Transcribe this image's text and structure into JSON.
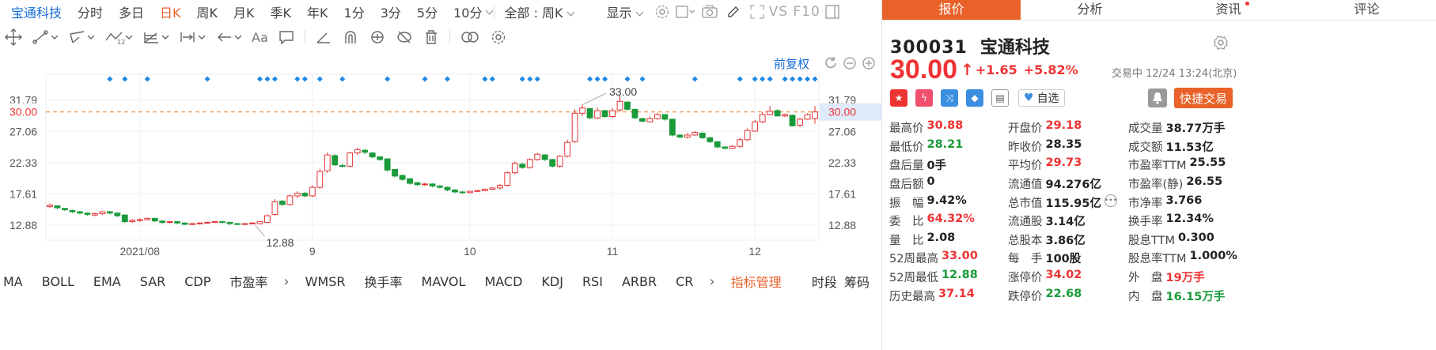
{
  "period_bar": {
    "items": [
      {
        "label": "宝通科技",
        "name": "stock-name-tab",
        "state": "first"
      },
      {
        "label": "分时",
        "name": "period-intraday"
      },
      {
        "label": "多日",
        "name": "period-multi-day"
      },
      {
        "label": "日K",
        "name": "period-daily",
        "state": "active"
      },
      {
        "label": "周K",
        "name": "period-weekly"
      },
      {
        "label": "月K",
        "name": "period-monthly"
      },
      {
        "label": "季K",
        "name": "period-quarterly"
      },
      {
        "label": "年K",
        "name": "period-yearly"
      },
      {
        "label": "1分",
        "name": "period-1min"
      },
      {
        "label": "3分",
        "name": "period-3min"
      },
      {
        "label": "5分",
        "name": "period-5min"
      },
      {
        "label": "10分",
        "name": "period-10min",
        "caret": true
      }
    ],
    "all_select": "全部 : 周K",
    "display": "显示",
    "vs_f10": "VS F10"
  },
  "chart": {
    "fuquan": "前复权",
    "price_line": "30.00"
  },
  "chart_data": {
    "type": "candlestick",
    "y_ticks_left": [
      "31.79",
      "27.06",
      "22.33",
      "17.61",
      "12.88"
    ],
    "y_ticks_right": [
      "31.79",
      "27.06",
      "22.33",
      "17.61",
      "12.88"
    ],
    "y_tick_values": [
      31.79,
      27.06,
      22.33,
      17.61,
      12.88
    ],
    "x_labels": [
      "2021/08",
      "9",
      "10",
      "11",
      "12"
    ],
    "ylim": [
      10.6,
      35.7
    ],
    "last_price": 30.0,
    "last_price_label": "30.00",
    "high_annotation": {
      "value": 33.0,
      "label": "33.00",
      "index": 71
    },
    "low_annotation": {
      "value": 12.88,
      "label": "12.88",
      "index": 28
    },
    "month_start_index": [
      12,
      35,
      56,
      75,
      94
    ],
    "signal_indices": [
      8,
      10,
      13,
      21,
      28,
      29,
      30,
      33,
      34,
      36,
      39,
      45,
      50,
      53,
      58,
      59,
      63,
      64,
      65,
      72,
      73,
      74,
      77,
      79,
      86,
      92,
      94,
      95,
      96,
      98,
      99,
      100,
      101,
      102
    ],
    "series": [
      {
        "close": [
          15.9,
          15.5,
          15.2,
          14.9,
          14.7,
          14.5,
          14.6,
          14.9,
          14.7,
          14.3,
          13.4,
          13.6,
          13.7,
          13.9,
          13.5,
          13.3,
          13.4,
          13.2,
          13.0,
          13.1,
          13.2,
          13.3,
          13.4,
          13.3,
          13.1,
          13.0,
          13.1,
          13.2,
          13.4,
          14.3,
          16.4,
          16.0,
          17.3,
          17.7,
          17.3,
          18.6,
          21.0,
          23.5,
          22.0,
          21.8,
          23.8,
          24.3,
          23.9,
          23.2,
          22.8,
          21.2,
          20.3,
          19.8,
          19.2,
          19.0,
          19.1,
          18.8,
          18.6,
          18.2,
          17.9,
          17.8,
          18.0,
          18.1,
          18.3,
          18.5,
          18.9,
          20.8,
          22.2,
          21.6,
          22.8,
          23.6,
          22.8,
          21.8,
          23.3,
          25.4,
          29.8,
          30.6,
          29.1,
          30.2,
          29.3,
          30.2,
          31.6,
          30.4,
          29.1,
          28.6,
          29.0,
          29.6,
          28.9,
          26.5,
          26.2,
          26.5,
          26.9,
          26.1,
          25.5,
          24.7,
          24.5,
          24.8,
          25.8,
          27.2,
          28.5,
          29.6,
          30.1,
          29.4,
          29.6,
          27.9,
          28.9,
          29.6,
          30.0
        ],
        "open": [
          15.7,
          15.8,
          15.4,
          15.1,
          14.9,
          14.7,
          14.4,
          14.6,
          14.9,
          14.7,
          14.4,
          13.4,
          13.6,
          13.7,
          13.9,
          13.5,
          13.3,
          13.4,
          13.2,
          13.0,
          13.1,
          13.2,
          13.3,
          13.4,
          13.3,
          13.1,
          13.0,
          13.1,
          13.1,
          13.3,
          14.5,
          16.5,
          16.0,
          17.3,
          17.7,
          17.3,
          18.6,
          21.1,
          23.4,
          21.9,
          21.8,
          23.8,
          24.2,
          23.8,
          23.2,
          22.9,
          21.3,
          20.4,
          19.9,
          19.3,
          19.0,
          19.1,
          18.8,
          18.6,
          18.2,
          17.9,
          17.8,
          18.0,
          18.1,
          18.3,
          18.5,
          18.9,
          20.8,
          22.1,
          21.6,
          22.8,
          23.5,
          22.8,
          21.8,
          23.3,
          25.5,
          29.8,
          30.5,
          29.1,
          30.2,
          29.3,
          30.3,
          31.5,
          30.4,
          29.0,
          28.5,
          29.0,
          29.6,
          28.9,
          26.5,
          26.2,
          26.5,
          26.8,
          26.1,
          25.5,
          24.7,
          24.5,
          24.8,
          25.8,
          27.1,
          28.5,
          29.6,
          30.2,
          29.4,
          29.5,
          28.0,
          28.9,
          29.0
        ],
        "high": [
          16.1,
          15.9,
          15.5,
          15.2,
          15.0,
          14.8,
          14.8,
          15.0,
          15.0,
          14.8,
          14.5,
          13.8,
          13.9,
          14.0,
          14.0,
          13.6,
          13.5,
          13.5,
          13.3,
          13.2,
          13.3,
          13.4,
          13.5,
          13.5,
          13.4,
          13.2,
          13.2,
          13.3,
          13.5,
          14.5,
          16.8,
          16.7,
          17.5,
          18.0,
          17.9,
          18.9,
          21.4,
          23.9,
          23.6,
          22.2,
          24.0,
          24.6,
          24.4,
          23.9,
          23.3,
          23.0,
          21.4,
          20.5,
          20.0,
          19.4,
          19.3,
          19.2,
          18.9,
          18.7,
          18.3,
          18.0,
          18.1,
          18.2,
          18.4,
          18.6,
          19.1,
          21.0,
          22.5,
          22.3,
          23.0,
          23.8,
          23.6,
          22.9,
          23.5,
          25.8,
          30.4,
          31.1,
          30.6,
          30.7,
          30.3,
          30.6,
          32.6,
          31.6,
          30.5,
          29.1,
          29.3,
          29.9,
          29.7,
          28.9,
          26.6,
          26.8,
          27.1,
          26.9,
          26.2,
          25.6,
          24.8,
          25.0,
          26.1,
          27.5,
          28.8,
          30.0,
          30.9,
          30.4,
          29.8,
          29.6,
          29.1,
          29.8,
          30.9
        ],
        "low": [
          15.5,
          15.3,
          15.0,
          14.7,
          14.5,
          14.3,
          14.2,
          14.4,
          14.5,
          14.1,
          13.2,
          13.2,
          13.4,
          13.6,
          13.4,
          13.1,
          13.1,
          13.0,
          12.9,
          12.9,
          13.0,
          13.1,
          13.2,
          13.1,
          12.9,
          12.88,
          12.9,
          13.0,
          13.0,
          13.2,
          14.3,
          15.8,
          15.8,
          17.0,
          17.1,
          17.1,
          18.4,
          20.8,
          21.8,
          21.6,
          21.6,
          23.5,
          23.6,
          23.0,
          22.6,
          21.0,
          20.1,
          19.6,
          19.0,
          18.8,
          18.8,
          18.6,
          18.4,
          18.0,
          17.7,
          17.6,
          17.7,
          17.9,
          18.0,
          18.2,
          18.3,
          18.7,
          20.6,
          21.4,
          21.4,
          22.6,
          22.6,
          21.6,
          21.6,
          23.1,
          25.3,
          29.4,
          28.9,
          28.9,
          29.1,
          29.1,
          30.1,
          30.2,
          28.9,
          28.4,
          28.4,
          28.8,
          28.7,
          26.3,
          26.0,
          26.0,
          26.4,
          25.9,
          25.3,
          24.5,
          24.3,
          24.4,
          24.6,
          25.6,
          27.0,
          28.3,
          29.5,
          29.3,
          29.2,
          27.8,
          27.7,
          28.8,
          28.21
        ]
      }
    ]
  },
  "draw_tools": [
    {
      "name": "crosshair-icon"
    },
    {
      "name": "line-tool-icon"
    },
    {
      "name": "channel-tool-icon"
    },
    {
      "name": "wave-tool-icon"
    },
    {
      "name": "fib-tool-icon"
    },
    {
      "name": "range-tool-icon"
    },
    {
      "name": "arrow-tool-icon"
    },
    {
      "name": "text-tool-icon"
    },
    {
      "name": "comment-tool-icon"
    },
    {
      "name": "angle-tool-icon"
    },
    {
      "name": "magnet-icon"
    },
    {
      "name": "lock-icon"
    },
    {
      "name": "hide-icon"
    },
    {
      "name": "trash-icon"
    },
    {
      "name": "link-icon"
    },
    {
      "name": "gear-icon"
    }
  ],
  "draw_tools_text": {
    "aa": "Aa"
  },
  "indicators": {
    "main": [
      "MA",
      "BOLL",
      "EMA",
      "SAR",
      "CDP",
      "市盈率"
    ],
    "sub": [
      "WMSR",
      "换手率",
      "MAVOL",
      "MACD",
      "KDJ",
      "RSI",
      "ARBR",
      "CR"
    ],
    "manage": "指标管理",
    "right": "时段 筹码"
  },
  "tabs": [
    {
      "label": "报价",
      "active": true
    },
    {
      "label": "分析"
    },
    {
      "label": "资讯",
      "dot": true
    },
    {
      "label": "评论"
    }
  ],
  "quote": {
    "code": "300031",
    "name": "宝通科技",
    "price": "30.00",
    "change": "+1.65",
    "change_pct": "+5.82%",
    "status": "交易中 12/24 13:24(北京)",
    "watch": "自选",
    "quick_trade": "快捷交易",
    "colors": {
      "up": "#e33333",
      "down": "#1a9b3a",
      "accent": "#e8622a"
    }
  },
  "stats": [
    [
      {
        "l": "最高价",
        "v": "30.88",
        "c": "red"
      },
      {
        "l": "开盘价",
        "v": "29.18",
        "c": "red"
      },
      {
        "l": "成交量",
        "v": "38.77万手",
        "c": "dark"
      }
    ],
    [
      {
        "l": "最低价",
        "v": "28.21",
        "c": "green"
      },
      {
        "l": "昨收价",
        "v": "28.35",
        "c": "dark"
      },
      {
        "l": "成交额",
        "v": "11.53亿",
        "c": "dark"
      }
    ],
    [
      {
        "l": "盘后量",
        "v": "0手",
        "c": "dark"
      },
      {
        "l": "平均价",
        "v": "29.73",
        "c": "red"
      },
      {
        "l": "市盈率TTM",
        "v": "25.55",
        "c": "dark"
      }
    ],
    [
      {
        "l": "盘后额",
        "v": "0",
        "c": "dark"
      },
      {
        "l": "流通值",
        "v": "94.276亿",
        "c": "dark"
      },
      {
        "l": "市盈率(静)",
        "v": "26.55",
        "c": "dark"
      }
    ],
    [
      {
        "l": "振　幅",
        "v": "9.42%",
        "c": "dark"
      },
      {
        "l": "总市值",
        "v": "115.95亿",
        "c": "dark",
        "more": true
      },
      {
        "l": "市净率",
        "v": "3.766",
        "c": "dark"
      }
    ],
    [
      {
        "l": "委　比",
        "v": "64.32%",
        "c": "red"
      },
      {
        "l": "流通股",
        "v": "3.14亿",
        "c": "dark"
      },
      {
        "l": "换手率",
        "v": "12.34%",
        "c": "dark"
      }
    ],
    [
      {
        "l": "量　比",
        "v": "2.08",
        "c": "dark"
      },
      {
        "l": "总股本",
        "v": "3.86亿",
        "c": "dark"
      },
      {
        "l": "股息TTM",
        "v": "0.300",
        "c": "dark"
      }
    ],
    [
      {
        "l": "52周最高",
        "v": "33.00",
        "c": "red"
      },
      {
        "l": "每　手",
        "v": "100股",
        "c": "dark"
      },
      {
        "l": "股息率TTM",
        "v": "1.000%",
        "c": "dark"
      }
    ],
    [
      {
        "l": "52周最低",
        "v": "12.88",
        "c": "green"
      },
      {
        "l": "涨停价",
        "v": "34.02",
        "c": "red"
      },
      {
        "l": "外　盘",
        "v": "19万手",
        "c": "red"
      }
    ],
    [
      {
        "l": "历史最高",
        "v": "37.14",
        "c": "red"
      },
      {
        "l": "跌停价",
        "v": "22.68",
        "c": "green"
      },
      {
        "l": "内　盘",
        "v": "16.15万手",
        "c": "green"
      }
    ]
  ]
}
